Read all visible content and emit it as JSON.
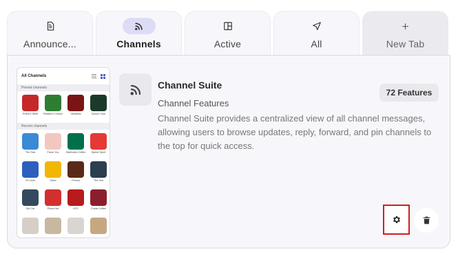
{
  "tabs": [
    {
      "label": "Announce...",
      "icon": "document-icon",
      "active": false
    },
    {
      "label": "Channels",
      "icon": "rss-icon",
      "active": true
    },
    {
      "label": "Active",
      "icon": "layout-icon",
      "active": false
    },
    {
      "label": "All",
      "icon": "navigation-icon",
      "active": false
    },
    {
      "label": "New Tab",
      "icon": "plus-icon",
      "active": false
    }
  ],
  "feature": {
    "title": "Channel Suite",
    "subtitle": "Channel Features",
    "badge": "72 Features",
    "description": "Channel Suite provides a centralized view of all channel messages, allowing users to browse updates, reply, forward, and pin channels to the top for quick access.",
    "icon": "rss-icon"
  },
  "preview": {
    "header": "All Channels",
    "pinned_label": "Pinned channels",
    "recent_label": "Recent channels",
    "pinned": [
      {
        "name": "Rhino's Steel",
        "color": "#c62828"
      },
      {
        "name": "Reader's Choice",
        "color": "#2e7d32"
      },
      {
        "name": "Vendetta",
        "color": "#7b1515"
      },
      {
        "name": "Soccer Club",
        "color": "#1b3a2a"
      }
    ],
    "recent": [
      {
        "name": "The Sea",
        "color": "#3a8ad6"
      },
      {
        "name": "Fresh You",
        "color": "#f2c7bf"
      },
      {
        "name": "Starbucks Coffee",
        "color": "#00704a"
      },
      {
        "name": "Speed Sport",
        "color": "#e53935"
      },
      {
        "name": "St Louis",
        "color": "#2d5fbf"
      },
      {
        "name": "Giant",
        "color": "#f2b705"
      },
      {
        "name": "Frenzy",
        "color": "#5a2a18"
      },
      {
        "name": "The Sea",
        "color": "#2c3e50"
      },
      {
        "name": "Old Car",
        "color": "#34495e"
      },
      {
        "name": "Pizza Hut",
        "color": "#d32f2f"
      },
      {
        "name": "KFC",
        "color": "#b71c1c"
      },
      {
        "name": "Costa Coffee",
        "color": "#8b1e2d"
      },
      {
        "name": "",
        "color": "#d5cfc8"
      },
      {
        "name": "",
        "color": "#c9b8a0"
      },
      {
        "name": "",
        "color": "#d9d5d0"
      },
      {
        "name": "",
        "color": "#c5a882"
      }
    ]
  },
  "actions": {
    "settings_icon": "gear-icon",
    "delete_icon": "trash-icon"
  },
  "colors": {
    "accent_tab_bg": "#dcdcf6",
    "highlight_border": "#cc1f1f"
  }
}
